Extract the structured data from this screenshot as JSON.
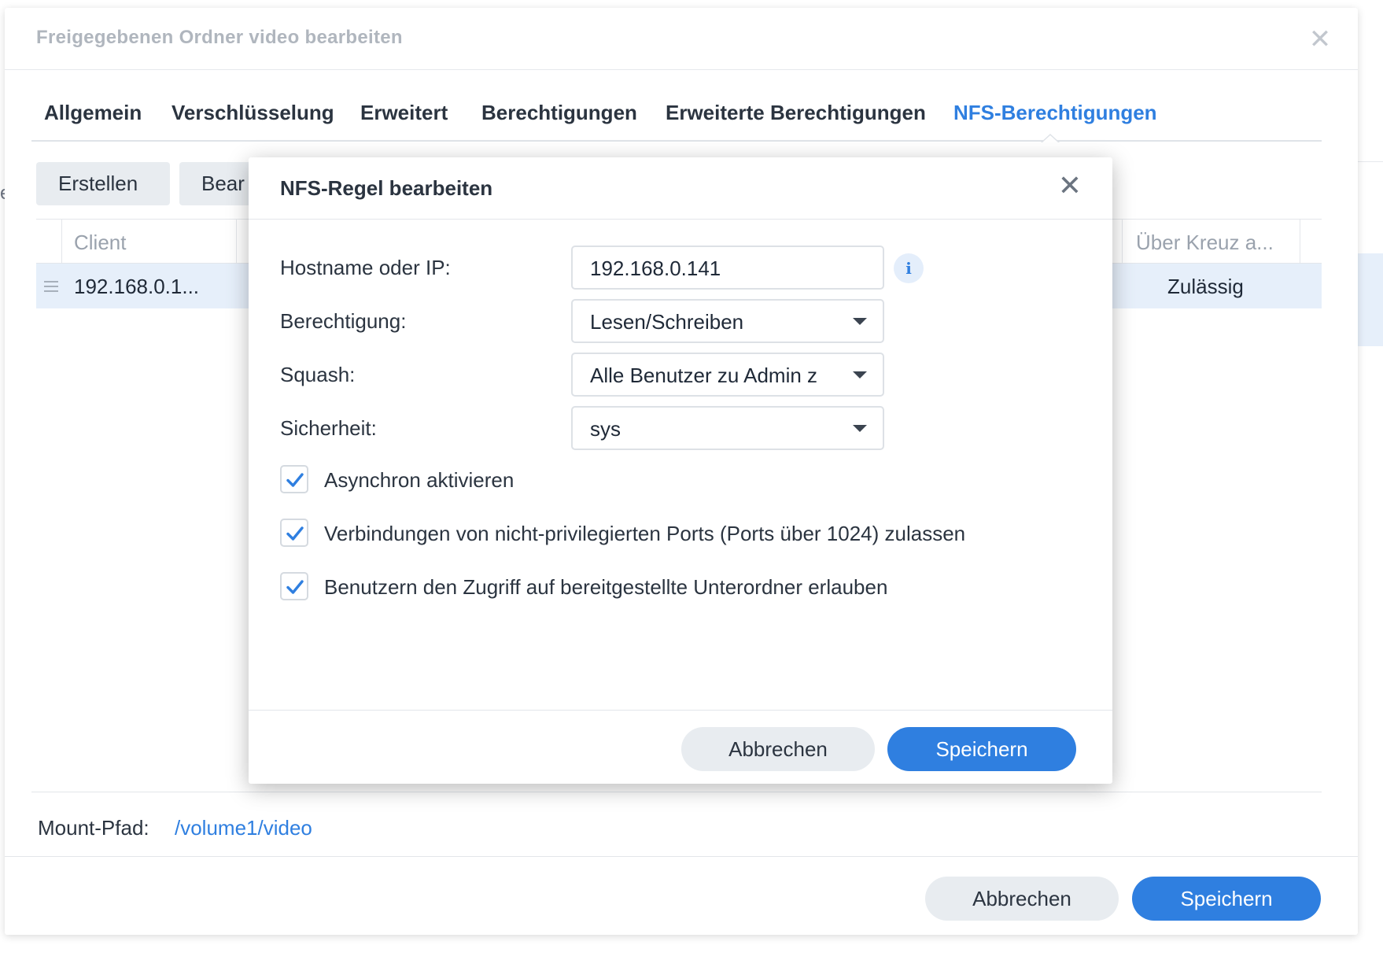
{
  "outer_dialog": {
    "title": "Freigegebenen Ordner video bearbeiten",
    "tabs": [
      {
        "label": "Allgemein"
      },
      {
        "label": "Verschlüsselung"
      },
      {
        "label": "Erweitert"
      },
      {
        "label": "Berechtigungen"
      },
      {
        "label": "Erweiterte Berechtigungen"
      },
      {
        "label": "NFS-Berechtigungen",
        "active": true
      }
    ],
    "toolbar": {
      "create_label": "Erstellen",
      "edit_label_partial": "Bear"
    },
    "grid": {
      "columns": [
        "Client",
        "Über Kreuz a..."
      ],
      "rows": [
        {
          "client": "192.168.0.1...",
          "cross_mount": "Zulässig",
          "selected": true
        }
      ]
    },
    "mount_path": {
      "label": "Mount-Pfad:",
      "value": "/volume1/video"
    },
    "footer": {
      "cancel_label": "Abbrechen",
      "save_label": "Speichern"
    }
  },
  "modal": {
    "title": "NFS-Regel bearbeiten",
    "fields": {
      "hostname": {
        "label": "Hostname oder IP:",
        "value": "192.168.0.141"
      },
      "permission": {
        "label": "Berechtigung:",
        "value": "Lesen/Schreiben"
      },
      "squash": {
        "label": "Squash:",
        "value": "Alle Benutzer zu Admin z"
      },
      "security": {
        "label": "Sicherheit:",
        "value": "sys"
      }
    },
    "checkboxes": [
      {
        "label": "Asynchron aktivieren",
        "checked": true
      },
      {
        "label": "Verbindungen von nicht-privilegierten Ports (Ports über 1024) zulassen",
        "checked": true
      },
      {
        "label": "Benutzern den Zugriff auf bereitgestellte Unterordner erlauben",
        "checked": true
      }
    ],
    "footer": {
      "cancel_label": "Abbrechen",
      "save_label": "Speichern"
    }
  },
  "colors": {
    "accent": "#2f7fe0",
    "selected_row": "#e6effa",
    "secondary_button": "#e8ecf0"
  },
  "icons": {
    "close": "close-icon",
    "info": "info-icon",
    "dropdown": "chevron-down-icon",
    "check": "check-icon",
    "drag": "drag-handle-icon"
  }
}
